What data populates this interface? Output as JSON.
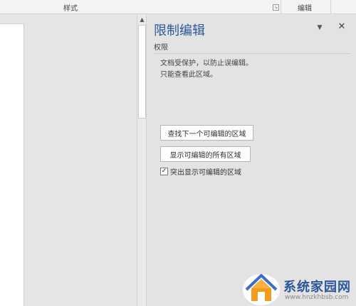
{
  "ribbon": {
    "styles_label": "样式",
    "edit_label": "编辑"
  },
  "pane": {
    "title": "限制编辑",
    "section_header": "权限",
    "desc_line1": "文档受保护，以防止误编辑。",
    "desc_line2": "只能查看此区域。",
    "find_next_button": "查找下一个可编辑的区域",
    "show_all_button": "显示可编辑的所有区域",
    "highlight_checkbox_label": "突出显示可编辑的区域",
    "highlight_checked": true
  },
  "watermark": {
    "site_name": "系统家园网",
    "site_url": "www.hnzkhbsb.com"
  },
  "colors": {
    "accent": "#2b579a",
    "pane_bg": "#e3e3e3",
    "ribbon_bg": "#f3f3f3"
  },
  "icons": {
    "pane_options": "chevron-down-icon",
    "pane_close": "close-icon",
    "scroll_up": "caret-up-icon",
    "launcher": "dialog-launcher-icon",
    "checkbox": "checkmark-icon",
    "logo": "house-logo-icon"
  }
}
